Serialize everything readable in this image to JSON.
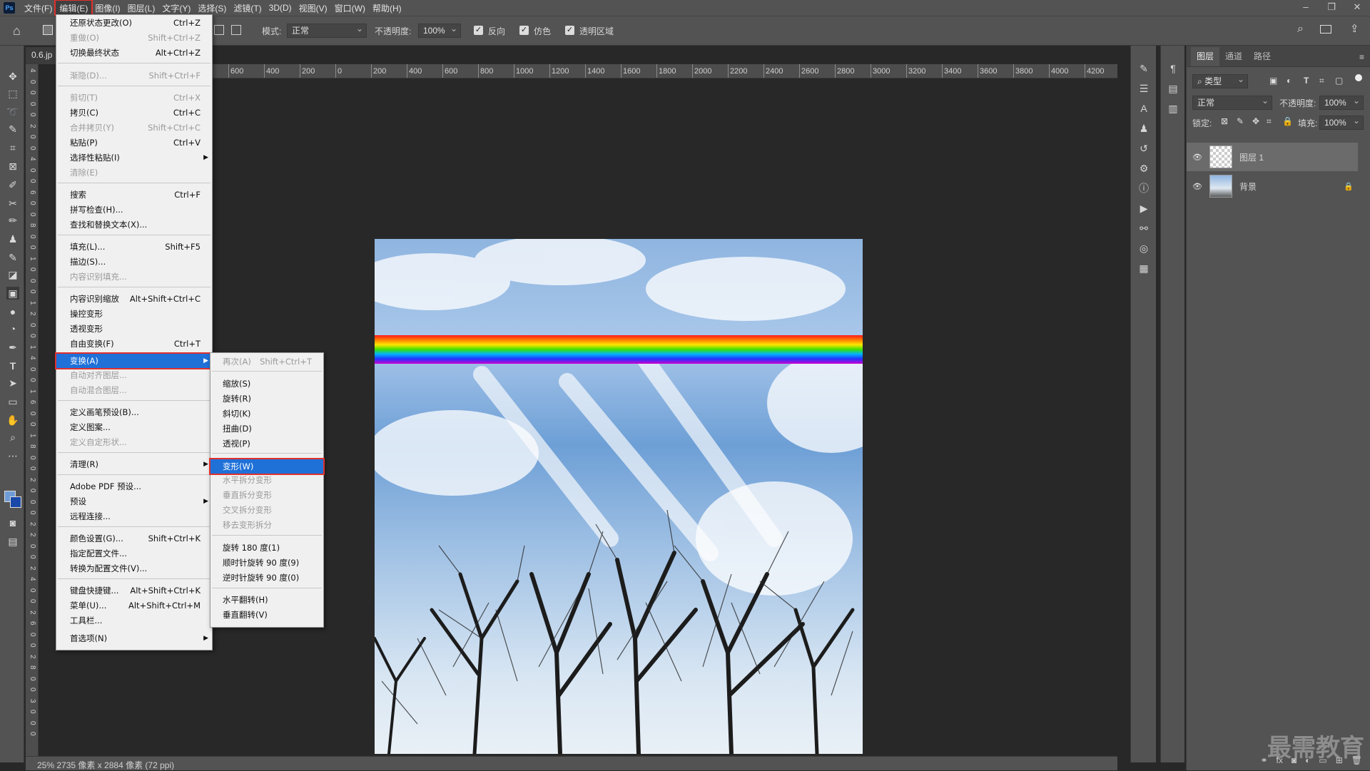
{
  "app": {
    "logo": "Ps"
  },
  "menubar": {
    "items": [
      "文件(F)",
      "编辑(E)",
      "图像(I)",
      "图层(L)",
      "文字(Y)",
      "选择(S)",
      "滤镜(T)",
      "3D(D)",
      "视图(V)",
      "窗口(W)",
      "帮助(H)"
    ],
    "active": "编辑(E)"
  },
  "window_controls": {
    "minimize": "–",
    "restore": "❐",
    "close": "✕"
  },
  "options": {
    "mode_label": "模式:",
    "mode_value": "正常",
    "opacity_label": "不透明度:",
    "opacity_value": "100%",
    "reverse_label": "反向",
    "dither_label": "仿色",
    "transparency_label": "透明区域"
  },
  "document": {
    "tab": "0.6.jp",
    "status": "25%   2735 像素 x 2884 像素 (72 ppi)"
  },
  "ruler_h_labels": [
    "600",
    "400",
    "200",
    "0",
    "200",
    "400",
    "600",
    "800",
    "1000",
    "1200",
    "1400",
    "1600",
    "1800",
    "2000",
    "2200",
    "2400",
    "2600",
    "2800",
    "3000",
    "3200",
    "3400",
    "3600",
    "3800",
    "4000",
    "4200"
  ],
  "ruler_v_labels": [
    "4",
    "0",
    "0",
    "0",
    "0",
    "2",
    "0",
    "0",
    "4",
    "0",
    "0",
    "6",
    "0",
    "0",
    "8",
    "0",
    "0",
    "1",
    "0",
    "0",
    "0",
    "1",
    "2",
    "0",
    "0",
    "1",
    "4",
    "0",
    "0",
    "1",
    "6",
    "0",
    "0",
    "1",
    "8",
    "0",
    "0",
    "2",
    "0",
    "0",
    "0",
    "2",
    "2",
    "0",
    "0",
    "2",
    "4",
    "0",
    "0",
    "2",
    "6",
    "0",
    "0",
    "2",
    "8",
    "0",
    "0",
    "3",
    "0",
    "0",
    "0"
  ],
  "edit_menu": {
    "items": [
      {
        "label": "还原状态更改(O)",
        "shortcut": "Ctrl+Z"
      },
      {
        "label": "重做(O)",
        "shortcut": "Shift+Ctrl+Z",
        "disabled": true
      },
      {
        "label": "切换最终状态",
        "shortcut": "Alt+Ctrl+Z"
      },
      {
        "label": "渐隐(D)...",
        "shortcut": "Shift+Ctrl+F",
        "disabled": true
      },
      {
        "label": "剪切(T)",
        "shortcut": "Ctrl+X",
        "disabled": true
      },
      {
        "label": "拷贝(C)",
        "shortcut": "Ctrl+C"
      },
      {
        "label": "合并拷贝(Y)",
        "shortcut": "Shift+Ctrl+C",
        "disabled": true
      },
      {
        "label": "粘贴(P)",
        "shortcut": "Ctrl+V"
      },
      {
        "label": "选择性粘贴(I)",
        "shortcut": ""
      },
      {
        "label": "清除(E)",
        "shortcut": "",
        "disabled": true
      },
      {
        "label": "搜索",
        "shortcut": "Ctrl+F"
      },
      {
        "label": "拼写检查(H)...",
        "shortcut": ""
      },
      {
        "label": "查找和替换文本(X)...",
        "shortcut": ""
      },
      {
        "label": "填充(L)...",
        "shortcut": "Shift+F5"
      },
      {
        "label": "描边(S)...",
        "shortcut": ""
      },
      {
        "label": "内容识别填充...",
        "shortcut": "",
        "disabled": true
      },
      {
        "label": "内容识别缩放",
        "shortcut": "Alt+Shift+Ctrl+C"
      },
      {
        "label": "操控变形",
        "shortcut": ""
      },
      {
        "label": "透视变形",
        "shortcut": ""
      },
      {
        "label": "自由变换(F)",
        "shortcut": "Ctrl+T"
      },
      {
        "label": "变换(A)",
        "shortcut": ""
      },
      {
        "label": "自动对齐图层...",
        "shortcut": "",
        "disabled": true
      },
      {
        "label": "自动混合图层...",
        "shortcut": "",
        "disabled": true
      },
      {
        "label": "定义画笔预设(B)...",
        "shortcut": ""
      },
      {
        "label": "定义图案...",
        "shortcut": ""
      },
      {
        "label": "定义自定形状...",
        "shortcut": "",
        "disabled": true
      },
      {
        "label": "清理(R)",
        "shortcut": ""
      },
      {
        "label": "Adobe PDF 预设...",
        "shortcut": ""
      },
      {
        "label": "预设",
        "shortcut": ""
      },
      {
        "label": "远程连接...",
        "shortcut": ""
      },
      {
        "label": "颜色设置(G)...",
        "shortcut": "Shift+Ctrl+K"
      },
      {
        "label": "指定配置文件...",
        "shortcut": ""
      },
      {
        "label": "转换为配置文件(V)...",
        "shortcut": ""
      },
      {
        "label": "键盘快捷键...",
        "shortcut": "Alt+Shift+Ctrl+K"
      },
      {
        "label": "菜单(U)...",
        "shortcut": "Alt+Shift+Ctrl+M"
      },
      {
        "label": "工具栏...",
        "shortcut": ""
      },
      {
        "label": "首选项(N)",
        "shortcut": ""
      }
    ]
  },
  "transform_menu": {
    "items": [
      {
        "label": "再次(A)",
        "shortcut": "Shift+Ctrl+T",
        "disabled": true
      },
      {
        "label": "缩放(S)"
      },
      {
        "label": "旋转(R)"
      },
      {
        "label": "斜切(K)"
      },
      {
        "label": "扭曲(D)"
      },
      {
        "label": "透视(P)"
      },
      {
        "label": "变形(W)"
      },
      {
        "label": "水平拆分变形",
        "disabled": true
      },
      {
        "label": "垂直拆分变形",
        "disabled": true
      },
      {
        "label": "交叉拆分变形",
        "disabled": true
      },
      {
        "label": "移去变形拆分",
        "disabled": true
      },
      {
        "label": "旋转 180 度(1)"
      },
      {
        "label": "顺时针旋转 90 度(9)"
      },
      {
        "label": "逆时针旋转 90 度(0)"
      },
      {
        "label": "水平翻转(H)"
      },
      {
        "label": "垂直翻转(V)"
      }
    ]
  },
  "layers_panel": {
    "tabs": [
      "图层",
      "通道",
      "路径"
    ],
    "filter": "类型",
    "blend_mode": "正常",
    "opacity_label": "不透明度:",
    "opacity_value": "100%",
    "lock_label": "锁定:",
    "fill_label": "填充:",
    "fill_value": "100%",
    "layers": [
      {
        "name": "图层 1",
        "selected": true
      },
      {
        "name": "背景",
        "locked": true
      }
    ]
  },
  "watermark": "最需教育"
}
